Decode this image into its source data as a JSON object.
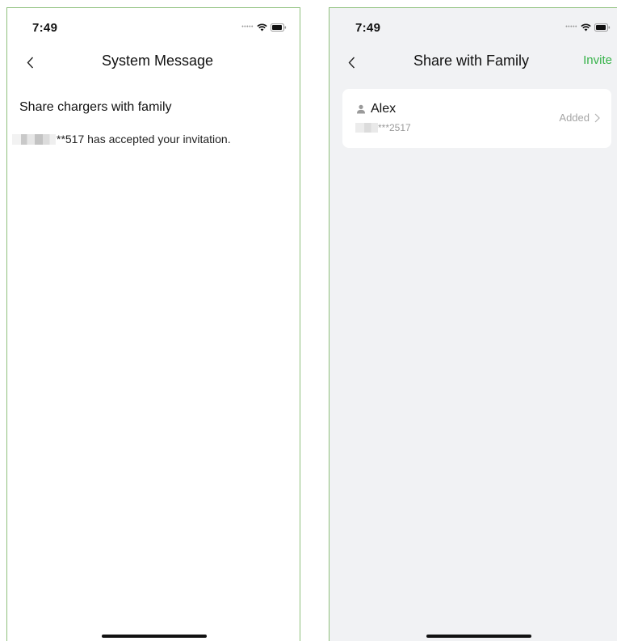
{
  "left_screen": {
    "status_bar": {
      "time": "7:49",
      "icons": [
        "signal-dots-icon",
        "wifi-icon",
        "battery-icon"
      ]
    },
    "nav": {
      "title": "System Message",
      "back_icon": "chevron-left-icon"
    },
    "message": {
      "heading": "Share chargers with family",
      "body": "**517 has accepted your invitation."
    }
  },
  "right_screen": {
    "status_bar": {
      "time": "7:49",
      "icons": [
        "signal-dots-icon",
        "wifi-icon",
        "battery-icon"
      ]
    },
    "nav": {
      "title": "Share with Family",
      "back_icon": "chevron-left-icon",
      "action_label": "Invite"
    },
    "members": [
      {
        "name": "Alex",
        "phone": "***2517",
        "status": "Added",
        "icon": "person-icon"
      }
    ]
  },
  "colors": {
    "accent": "#37b34a",
    "background_right": "#f1f2f4",
    "frame_border": "#8ec07c"
  }
}
